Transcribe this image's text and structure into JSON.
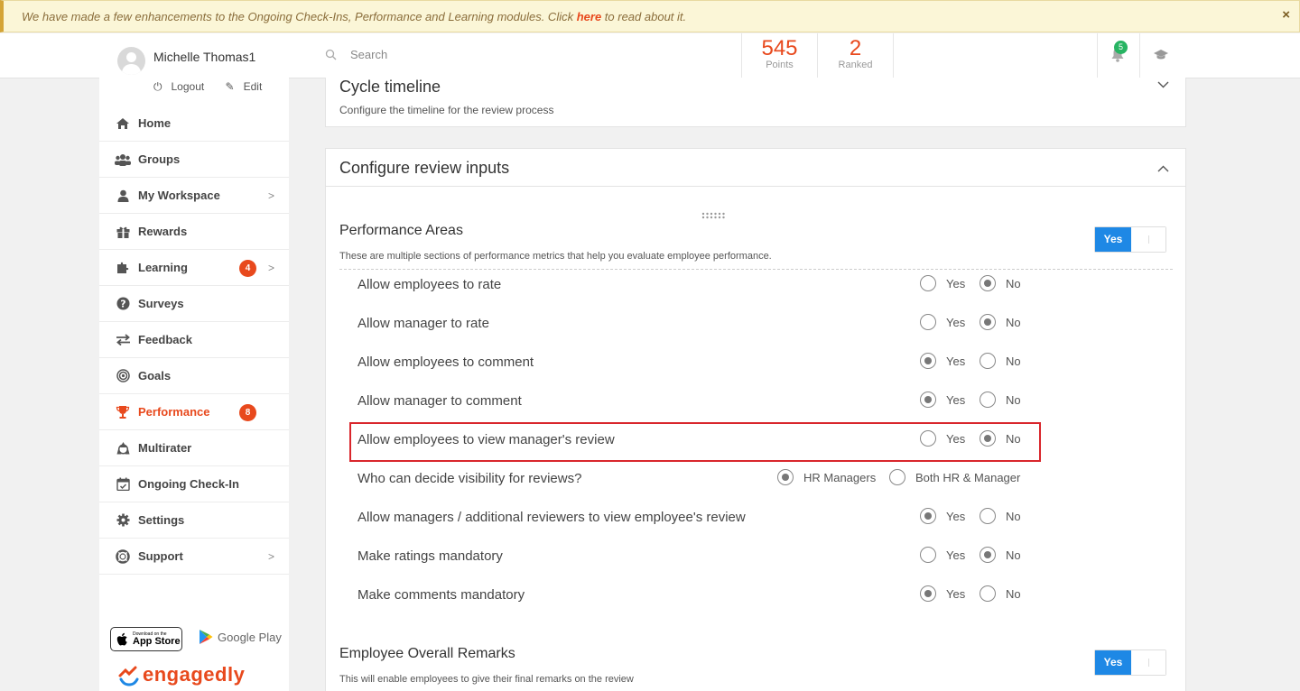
{
  "banner": {
    "text_before": "We have made a few enhancements to the Ongoing Check-Ins, Performance and Learning modules. Click ",
    "link": "here",
    "text_after": " to read about it.",
    "close": "×"
  },
  "user": {
    "name": "Michelle Thomas1",
    "logout": "Logout",
    "edit": "Edit"
  },
  "header": {
    "search_placeholder": "Search",
    "points_value": "545",
    "points_label": "Points",
    "ranked_value": "2",
    "ranked_label": "Ranked",
    "notifications_count": "5"
  },
  "sidebar": {
    "items": [
      {
        "label": "Home",
        "icon": "home-icon"
      },
      {
        "label": "Groups",
        "icon": "groups-icon"
      },
      {
        "label": "My Workspace",
        "icon": "user-icon",
        "chevron": true
      },
      {
        "label": "Rewards",
        "icon": "gift-icon"
      },
      {
        "label": "Learning",
        "icon": "puzzle-icon",
        "badge": "4",
        "chevron": true
      },
      {
        "label": "Surveys",
        "icon": "question-icon"
      },
      {
        "label": "Feedback",
        "icon": "exchange-icon"
      },
      {
        "label": "Goals",
        "icon": "target-icon"
      },
      {
        "label": "Performance",
        "icon": "trophy-icon",
        "badge": "8",
        "active": true
      },
      {
        "label": "Multirater",
        "icon": "recycle-icon"
      },
      {
        "label": "Ongoing Check-In",
        "icon": "calendar-check-icon"
      },
      {
        "label": "Settings",
        "icon": "gear-icon"
      },
      {
        "label": "Support",
        "icon": "lifebuoy-icon",
        "chevron": true
      }
    ],
    "appstore_small": "Download on the",
    "appstore_big": "App Store",
    "googleplay": "Google Play",
    "logo": "engagedly"
  },
  "cycle": {
    "title": "Cycle timeline",
    "subtitle": "Configure the timeline for the review process"
  },
  "review_inputs": {
    "title": "Configure review inputs",
    "performance_areas": {
      "title": "Performance Areas",
      "subtitle": "These are multiple sections of performance metrics that help you evaluate employee performance.",
      "toggle": "Yes"
    },
    "settings": [
      {
        "label": "Allow employees to rate",
        "options": [
          "Yes",
          "No"
        ],
        "selected": "No"
      },
      {
        "label": "Allow manager to rate",
        "options": [
          "Yes",
          "No"
        ],
        "selected": "No"
      },
      {
        "label": "Allow employees to comment",
        "options": [
          "Yes",
          "No"
        ],
        "selected": "Yes"
      },
      {
        "label": "Allow manager to comment",
        "options": [
          "Yes",
          "No"
        ],
        "selected": "Yes"
      },
      {
        "label": "Allow employees to view manager's review",
        "options": [
          "Yes",
          "No"
        ],
        "selected": "No",
        "highlighted": true
      },
      {
        "label": "Who can decide visibility for reviews?",
        "options": [
          "HR Managers",
          "Both HR & Manager"
        ],
        "selected": "HR Managers"
      },
      {
        "label": "Allow managers / additional reviewers to view employee's review",
        "options": [
          "Yes",
          "No"
        ],
        "selected": "Yes"
      },
      {
        "label": "Make ratings mandatory",
        "options": [
          "Yes",
          "No"
        ],
        "selected": "No"
      },
      {
        "label": "Make comments mandatory",
        "options": [
          "Yes",
          "No"
        ],
        "selected": "Yes"
      }
    ],
    "overall_remarks": {
      "title": "Employee Overall Remarks",
      "subtitle": "This will enable employees to give their final remarks on the review",
      "toggle": "Yes"
    }
  }
}
